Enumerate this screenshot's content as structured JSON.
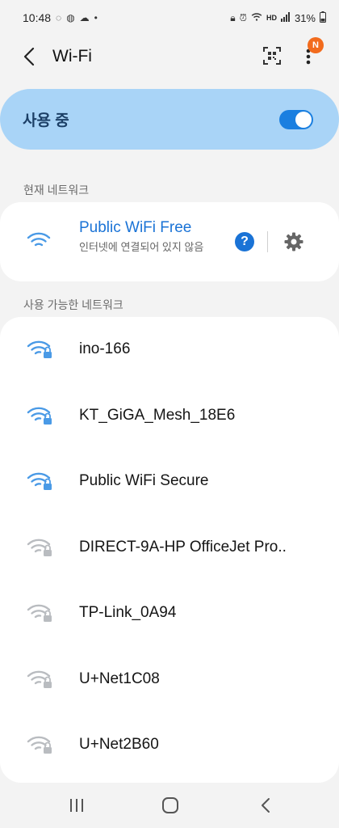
{
  "status_bar": {
    "time": "10:48",
    "battery": "31%",
    "network_label": "HD"
  },
  "header": {
    "title": "Wi-Fi",
    "badge": "N"
  },
  "master_switch": {
    "label": "사용 중",
    "on": true
  },
  "current_section": {
    "label": "현재 네트워크",
    "network": {
      "ssid": "Public WiFi Free",
      "status": "인터넷에 연결되어 있지 않음",
      "help": "?"
    }
  },
  "available_section": {
    "label": "사용 가능한 네트워크",
    "networks": [
      {
        "name": "ino-166",
        "strength": "strong"
      },
      {
        "name": "KT_GiGA_Mesh_18E6",
        "strength": "strong"
      },
      {
        "name": "Public WiFi Secure",
        "strength": "strong"
      },
      {
        "name": "DIRECT-9A-HP OfficeJet Pro..",
        "strength": "weak"
      },
      {
        "name": "TP-Link_0A94",
        "strength": "weak"
      },
      {
        "name": "U+Net1C08",
        "strength": "weak"
      },
      {
        "name": "U+Net2B60",
        "strength": "weak"
      }
    ]
  },
  "colors": {
    "accent": "#1a73d6",
    "wifi_strong": "#4a9ae6",
    "wifi_weak": "#b9bcc0",
    "master_bg": "#a9d4f7"
  }
}
